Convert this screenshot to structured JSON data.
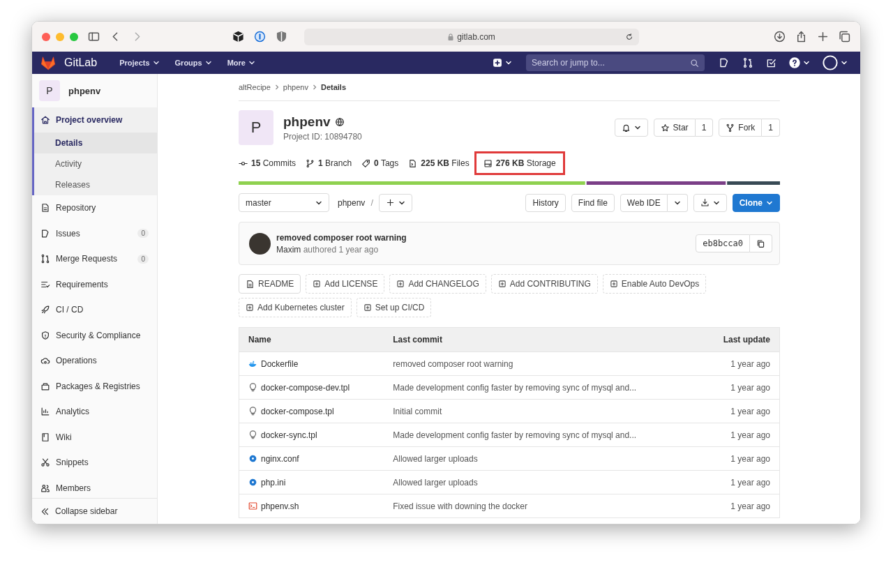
{
  "browser": {
    "url": "gitlab.com"
  },
  "navbar": {
    "brand": "GitLab",
    "menus": [
      "Projects",
      "Groups",
      "More"
    ],
    "search": {
      "placeholder": "Search or jump to..."
    }
  },
  "sidebar": {
    "project": {
      "avatar": "P",
      "name": "phpenv"
    },
    "items": [
      {
        "label": "Project overview",
        "selected": true,
        "children": [
          {
            "label": "Details",
            "selected": true
          },
          {
            "label": "Activity",
            "selected": false
          },
          {
            "label": "Releases",
            "selected": false
          }
        ]
      },
      {
        "label": "Repository",
        "selected": false
      },
      {
        "label": "Issues",
        "selected": false,
        "count": "0"
      },
      {
        "label": "Merge Requests",
        "selected": false,
        "count": "0"
      },
      {
        "label": "Requirements",
        "selected": false
      },
      {
        "label": "CI / CD",
        "selected": false
      },
      {
        "label": "Security & Compliance",
        "selected": false
      },
      {
        "label": "Operations",
        "selected": false
      },
      {
        "label": "Packages & Registries",
        "selected": false
      },
      {
        "label": "Analytics",
        "selected": false
      },
      {
        "label": "Wiki",
        "selected": false
      },
      {
        "label": "Snippets",
        "selected": false
      },
      {
        "label": "Members",
        "selected": false
      }
    ],
    "collapse": "Collapse sidebar"
  },
  "breadcrumbs": [
    "altRecipe",
    "phpenv",
    "Details"
  ],
  "project": {
    "avatar": "P",
    "name": "phpenv",
    "id": "Project ID: 10894780",
    "star": {
      "label": "Star",
      "count": "1"
    },
    "fork": {
      "label": "Fork",
      "count": "1"
    }
  },
  "stats": [
    {
      "count": "15",
      "label": "Commits",
      "highlighted": false
    },
    {
      "count": "1",
      "label": "Branch",
      "highlighted": false
    },
    {
      "count": "0",
      "label": "Tags",
      "highlighted": false
    },
    {
      "count": "225 KB",
      "label": "Files",
      "highlighted": false
    },
    {
      "count": "276 KB",
      "label": "Storage",
      "highlighted": true
    }
  ],
  "toolbar": {
    "branch": "master",
    "path": "phpenv",
    "separator": "/",
    "buttons": [
      "History",
      "Find file"
    ],
    "web_ide": "Web IDE",
    "clone": "Clone"
  },
  "last_commit": {
    "title": "removed composer root warning",
    "author": "Maxim",
    "meta": "authored 1 year ago",
    "sha": "eb8bcca0"
  },
  "quick_actions": [
    {
      "kind": "existing",
      "label": "README"
    },
    {
      "kind": "add",
      "label": "Add LICENSE"
    },
    {
      "kind": "add",
      "label": "Add CHANGELOG"
    },
    {
      "kind": "add",
      "label": "Add CONTRIBUTING"
    },
    {
      "kind": "add",
      "label": "Enable Auto DevOps"
    },
    {
      "kind": "add",
      "label": "Add Kubernetes cluster"
    },
    {
      "kind": "add",
      "label": "Set up CI/CD"
    }
  ],
  "table": {
    "columns": [
      "Name",
      "Last commit",
      "Last update"
    ],
    "rows": [
      {
        "kind": "docker",
        "name": "Dockerfile",
        "commit": "removed composer root warning",
        "updated": "1 year ago"
      },
      {
        "kind": "template",
        "name": "docker-compose-dev.tpl",
        "commit": "Made development config faster by removing sync of mysql and...",
        "updated": "1 year ago"
      },
      {
        "kind": "template",
        "name": "docker-compose.tpl",
        "commit": "Initial commit",
        "updated": "1 year ago"
      },
      {
        "kind": "template",
        "name": "docker-sync.tpl",
        "commit": "Made development config faster by removing sync of mysql and...",
        "updated": "1 year ago"
      },
      {
        "kind": "config",
        "name": "nginx.conf",
        "commit": "Allowed larger uploads",
        "updated": "1 year ago"
      },
      {
        "kind": "config",
        "name": "php.ini",
        "commit": "Allowed larger uploads",
        "updated": "1 year ago"
      },
      {
        "kind": "shell",
        "name": "phpenv.sh",
        "commit": "Fixed issue with downing the docker",
        "updated": "1 year ago"
      }
    ]
  }
}
